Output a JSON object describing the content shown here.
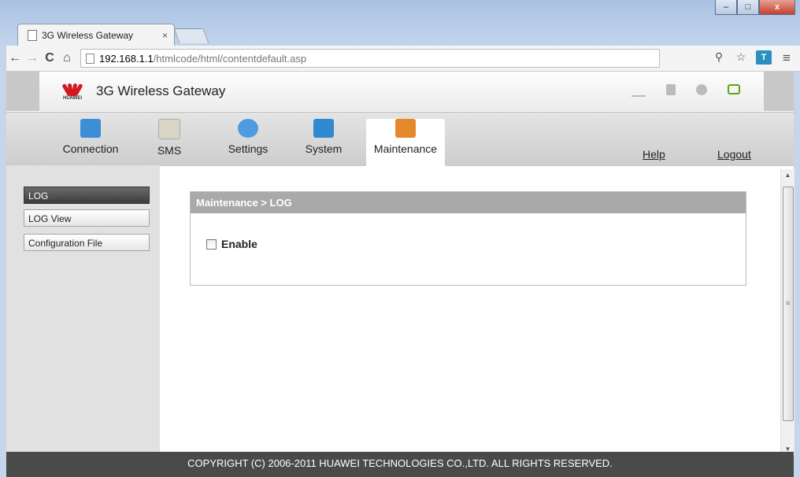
{
  "browser": {
    "tab_title": "3G Wireless Gateway",
    "tab_close": "×",
    "url_host": "192.168.1.1",
    "url_path": "/htmlcode/html/contentdefault.asp",
    "window_buttons": {
      "minimize": "–",
      "maximize": "□",
      "close": "x"
    },
    "nav": {
      "back": "←",
      "forward": "→",
      "reload": "C",
      "home": "⌂"
    },
    "toolbar_icons": {
      "zoom": "⚲",
      "star": "☆",
      "menu": "≡",
      "extension": "T"
    }
  },
  "header": {
    "brand": "HUAWEI",
    "title": "3G Wireless Gateway"
  },
  "nav": {
    "items": [
      {
        "label": "Connection",
        "icon": "connection-icon",
        "color": "#3c8fd6"
      },
      {
        "label": "SMS",
        "icon": "sms-envelope-icon",
        "color": "#d9d6c6"
      },
      {
        "label": "Settings",
        "icon": "settings-gear-icon",
        "color": "#4f9be0"
      },
      {
        "label": "System",
        "icon": "system-monitor-icon",
        "color": "#2f8ad2"
      },
      {
        "label": "Maintenance",
        "icon": "maintenance-toolbox-icon",
        "color": "#e38a2b"
      }
    ],
    "active": "Maintenance",
    "help": "Help",
    "logout": "Logout"
  },
  "sidebar": {
    "items": [
      {
        "label": "LOG",
        "active": true
      },
      {
        "label": "LOG View",
        "active": false
      },
      {
        "label": "Configuration File",
        "active": false
      }
    ]
  },
  "main": {
    "breadcrumb": "Maintenance > LOG",
    "enable_label": "Enable",
    "enable_checked": false
  },
  "scrollbar": {
    "up": "▲",
    "down": "▼",
    "grip": "≡"
  },
  "footer": {
    "copyright": "COPYRIGHT (C) 2006-2011 HUAWEI TECHNOLOGIES CO.,LTD. ALL RIGHTS RESERVED."
  }
}
